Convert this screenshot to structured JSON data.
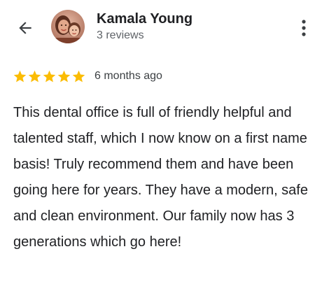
{
  "reviewer": {
    "name": "Kamala Young",
    "review_count": "3 reviews"
  },
  "review": {
    "rating": 5,
    "max_rating": 5,
    "time": "6 months ago",
    "text": "This dental office is full of friendly helpful and talented staff, which I now know on a first name basis! Truly recommend them and have been going here for years. They have a modern, safe and clean environment. Our family now has 3 generations which go here!"
  },
  "icons": {
    "back": "arrow-back-icon",
    "more": "more-vert-icon",
    "star": "star-icon"
  },
  "colors": {
    "star": "#fbbc04",
    "text": "#202124",
    "secondary": "#5f6368",
    "icon": "#5f6368"
  }
}
